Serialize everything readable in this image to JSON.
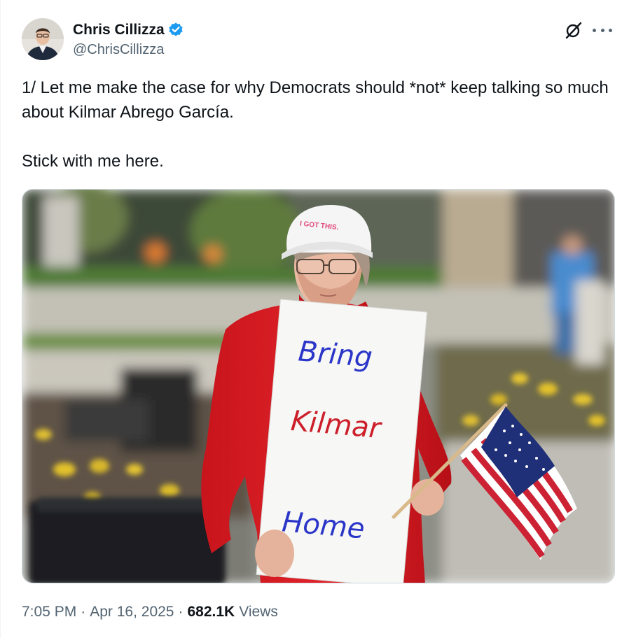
{
  "author": {
    "display_name": "Chris Cillizza",
    "handle": "@ChrisCillizza",
    "verified": true,
    "verified_color": "#1d9bf0"
  },
  "header_actions": {
    "grok_icon": "grok-icon",
    "more_icon": "more-icon"
  },
  "tweet": {
    "paragraph_1": "1/ Let me make the case for why Democrats should *not* keep talking so much about Kilmar Abrego García.",
    "paragraph_2": "Stick with me here."
  },
  "media": {
    "hat_text": "I GOT THIS.",
    "sign_line_1": "Bring",
    "sign_line_2": "Kilmar",
    "sign_line_3": "Home"
  },
  "meta": {
    "time": "7:05 PM",
    "separator": "·",
    "date": "Apr 16, 2025",
    "views_count": "682.1K",
    "views_label": "Views"
  },
  "colors": {
    "text_primary": "#0f1419",
    "text_secondary": "#536471",
    "border": "#cfd9de"
  }
}
